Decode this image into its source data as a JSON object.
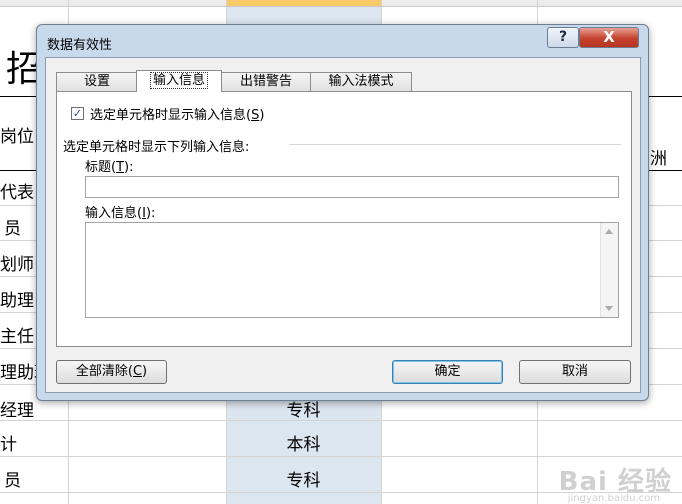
{
  "sheet": {
    "title_partial": "招",
    "header_partial": "岗位",
    "header_right_partial": "洲",
    "rows": [
      "代表",
      "员",
      "划师",
      "助理",
      "主任",
      "理助理",
      "经理",
      "计",
      "员"
    ],
    "edu_values": [
      "专科",
      "本科",
      "专科"
    ],
    "watermark": "Bai 经验",
    "watermark_sub": "jingyan.baidu.com"
  },
  "dialog": {
    "title": "数据有效性",
    "help_glyph": "?",
    "close_glyph": "X",
    "tabs": [
      {
        "label": "设置",
        "active": false
      },
      {
        "label": "输入信息",
        "active": true
      },
      {
        "label": "出错警告",
        "active": false
      },
      {
        "label": "输入法模式",
        "active": false
      }
    ],
    "show_input_checkbox": {
      "label": "选定单元格时显示输入信息",
      "hotkey": "S",
      "checked": true
    },
    "group_label": "选定单元格时显示下列输入信息:",
    "title_field": {
      "label": "标题",
      "hotkey": "T",
      "value": ""
    },
    "message_field": {
      "label": "输入信息",
      "hotkey": "I",
      "value": ""
    },
    "buttons": {
      "clear_all": {
        "label": "全部清除",
        "hotkey": "C"
      },
      "ok": "确定",
      "cancel": "取消"
    },
    "check_glyph": "✓"
  }
}
